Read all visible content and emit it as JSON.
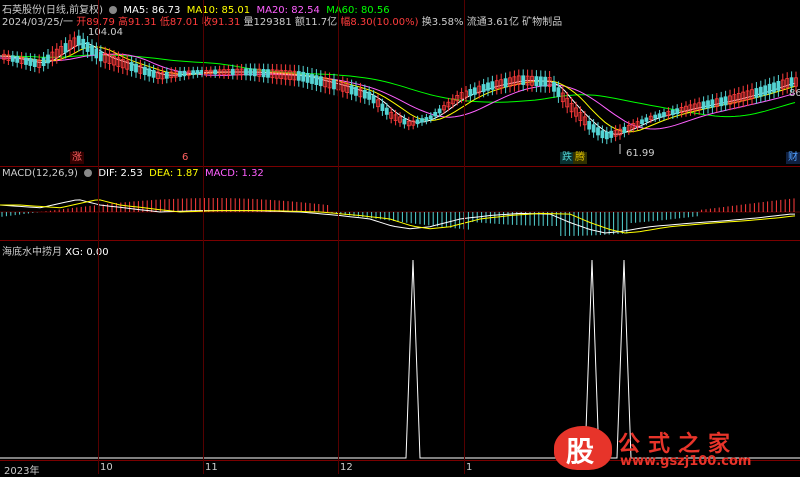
{
  "header": {
    "stock_name": "石英股份(日线,前复权)",
    "ma5": "MA5: 86.73",
    "ma10": "MA10: 85.01",
    "ma20": "MA20: 82.54",
    "ma60": "MA60: 80.56",
    "date": "2024/03/25/一",
    "open": "开89.79",
    "high": "高91.31",
    "low": "低87.01",
    "close": "收91.31",
    "volume": "量129381",
    "amount": "额11.7亿",
    "range": "幅8.30(10.00%)",
    "turnover": "换3.58%",
    "float_value": "流通3.61亿",
    "sector": "矿物制品"
  },
  "main": {
    "top_left_label": "104.04",
    "low_label": "61.99",
    "right_price": "86",
    "badges": [
      {
        "text": "涨",
        "color": "#ff6060"
      },
      {
        "text": "6",
        "color": "#ff6060"
      },
      {
        "text": "跌",
        "color": "#50d0d0"
      },
      {
        "text": "腾",
        "color": "#e0c000"
      },
      {
        "text": "财",
        "color": "#50a0ff"
      }
    ]
  },
  "macd": {
    "title": "MACD(12,26,9)",
    "dif": "DIF: 2.53",
    "dea": "DEA: 1.87",
    "macd": "MACD: 1.32"
  },
  "xg": {
    "title": "海底水中捞月",
    "value": "XG: 0.00"
  },
  "xaxis": {
    "labels": [
      "2023年",
      "10",
      "11",
      "12",
      "1"
    ]
  },
  "watermark": {
    "logo_char": "股",
    "title": "公式之家",
    "url": "www.gszj100.com"
  },
  "colors": {
    "up": "#ff3c3c",
    "down": "#54d4d4",
    "ma5": "#ffffff",
    "ma10": "#ffff00",
    "ma20": "#ff60ff",
    "ma60": "#00ff00"
  }
}
